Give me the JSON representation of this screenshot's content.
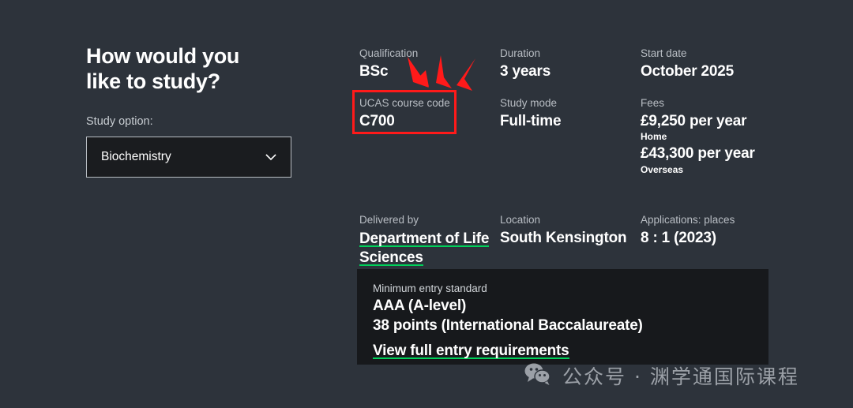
{
  "left_panel": {
    "title": "How would you\nlike to study?",
    "study_option_label": "Study option:",
    "select_value": "Biochemistry",
    "chevron_icon": "chevron-down-icon"
  },
  "details": {
    "row1": [
      {
        "label": "Qualification",
        "value": "BSc"
      },
      {
        "label": "Duration",
        "value": "3 years"
      },
      {
        "label": "Start date",
        "value": "October 2025"
      }
    ],
    "row2": [
      {
        "label": "UCAS course code",
        "value": "C700"
      },
      {
        "label": "Study mode",
        "value": "Full-time"
      },
      {
        "label": "Fees",
        "value": "£9,250 per year",
        "note": "Home",
        "value2": "£43,300 per year",
        "note2": "Overseas"
      }
    ],
    "row3": [
      {
        "label": "Delivered by",
        "value": "Department of Life Sciences",
        "is_link": true
      },
      {
        "label": "Location",
        "value": "South Kensington"
      },
      {
        "label": "Applications: places",
        "value": "8 : 1 (2023)"
      }
    ]
  },
  "entry_box": {
    "label": "Minimum entry standard",
    "line1": "AAA (A-level)",
    "line2": "38 points (International Baccalaureate)",
    "link": "View full entry requirements"
  },
  "annotations": {
    "highlight_rect_target": "ucas-course-code-field",
    "arrow_count": 3,
    "color": "#ff1a1a"
  },
  "watermark": {
    "icon": "wechat-icon",
    "text": "公众号 · 渊学通国际课程"
  },
  "colors": {
    "background": "#2d333b",
    "panel_background": "#17191c",
    "accent_green": "#00d15a",
    "annotation_red": "#ff1a1a",
    "label_grey": "#b9bec4"
  }
}
